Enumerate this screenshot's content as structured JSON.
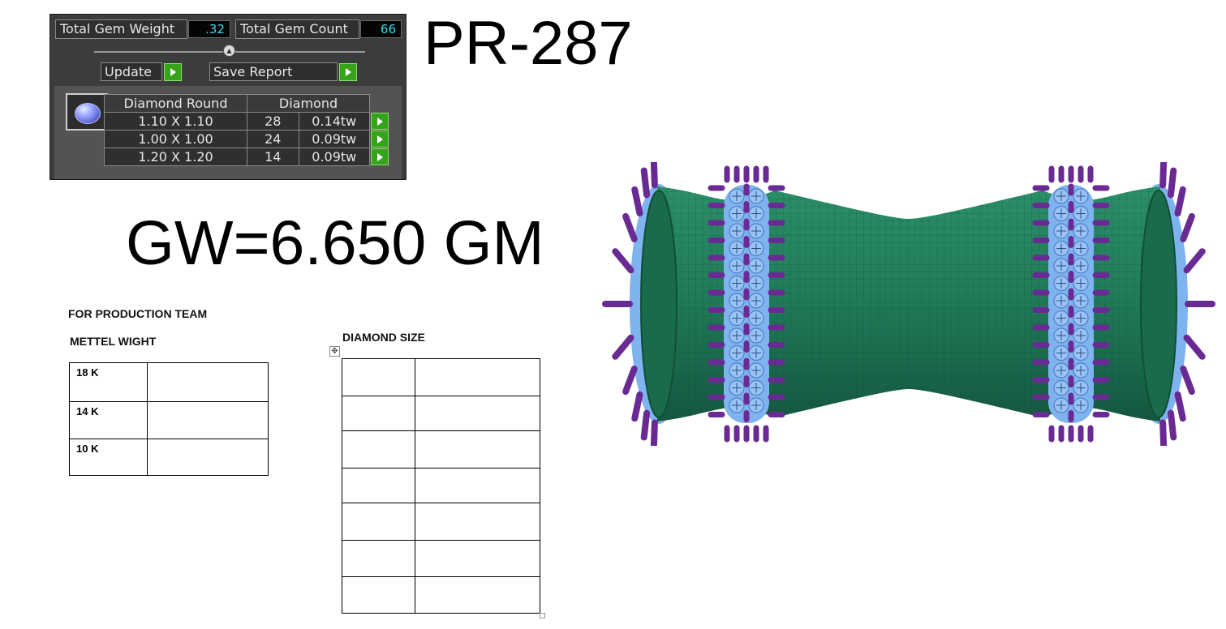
{
  "gem_panel": {
    "total_weight_label": "Total Gem Weight",
    "total_weight_value": ".32",
    "total_count_label": "Total Gem Count",
    "total_count_value": "66",
    "update_label": "Update",
    "save_report_label": "Save Report",
    "table": {
      "headers": [
        "Diamond Round",
        "Diamond"
      ],
      "rows": [
        {
          "size": "1.10 X 1.10",
          "count": "28",
          "weight": "0.14tw"
        },
        {
          "size": "1.00 X 1.00",
          "count": "24",
          "weight": "0.09tw"
        },
        {
          "size": "1.20 X 1.20",
          "count": "14",
          "weight": "0.09tw"
        }
      ]
    }
  },
  "model_code": "PR-287",
  "gross_weight": "GW=6.650 GM",
  "production_sheet": {
    "title": "FOR PRODUCTION TEAM",
    "metal_heading": "METTEL WIGHT",
    "metal_rows": [
      {
        "karat": "18 K",
        "weight": ""
      },
      {
        "karat": "14 K",
        "weight": ""
      },
      {
        "karat": "10 K",
        "weight": ""
      }
    ],
    "diamond_heading": "DIAMOND SIZE",
    "diamond_rows": [
      {
        "size": "",
        "value": ""
      },
      {
        "size": "",
        "value": ""
      },
      {
        "size": "",
        "value": ""
      },
      {
        "size": "",
        "value": ""
      },
      {
        "size": "",
        "value": ""
      },
      {
        "size": "",
        "value": ""
      },
      {
        "size": "",
        "value": ""
      }
    ]
  },
  "icons": {
    "gem_thumb": "round-diamond-icon",
    "row_action": "play-arrow-icon",
    "table_move": "move-handle-icon"
  },
  "colors": {
    "ring_metal": "#1f7a58",
    "ring_stone": "#7fb3ef",
    "ring_prong": "#6a2a94",
    "panel_value_text": "#36d8ee",
    "action_green": "#36a41a"
  }
}
